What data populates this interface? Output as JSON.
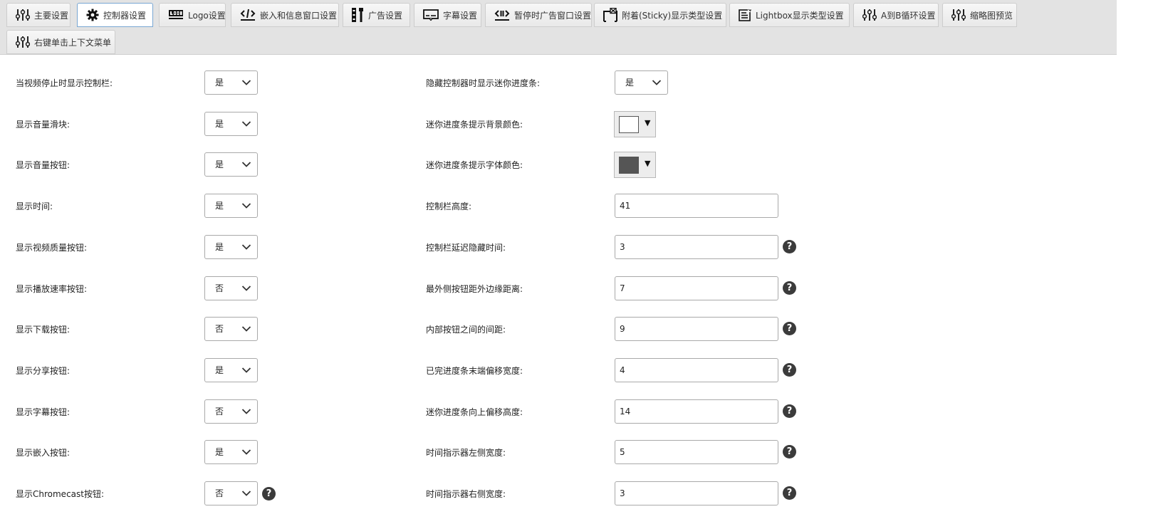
{
  "tabs": [
    {
      "label": "主要设置",
      "icon": "sliders-icon",
      "active": false
    },
    {
      "label": "控制器设置",
      "icon": "gear-icon",
      "active": true
    },
    {
      "label": "Logo设置",
      "icon": "logo-icon",
      "active": false
    },
    {
      "label": "嵌入和信息窗口设置",
      "icon": "embed-icon",
      "active": false
    },
    {
      "label": "广告设置",
      "icon": "ad-icon",
      "active": false
    },
    {
      "label": "字幕设置",
      "icon": "subtitle-icon",
      "active": false
    },
    {
      "label": "暂停时广告窗口设置",
      "icon": "pause-ad-icon",
      "active": false
    },
    {
      "label": "附着(Sticky)显示类型设置",
      "icon": "sticky-icon",
      "active": false
    },
    {
      "label": "Lightbox显示类型设置",
      "icon": "lightbox-icon",
      "active": false
    },
    {
      "label": "A到B循环设置",
      "icon": "sliders-icon",
      "active": false
    },
    {
      "label": "缩略图预览",
      "icon": "sliders-icon",
      "active": false
    },
    {
      "label": "右键单击上下文菜单",
      "icon": "sliders-icon",
      "active": false
    }
  ],
  "left_settings": [
    {
      "label": "当视频停止时显示控制栏:",
      "value": "是"
    },
    {
      "label": "显示音量滑块:",
      "value": "是"
    },
    {
      "label": "显示音量按钮:",
      "value": "是"
    },
    {
      "label": "显示时间:",
      "value": "是"
    },
    {
      "label": "显示视频质量按钮:",
      "value": "是"
    },
    {
      "label": "显示播放速率按钮:",
      "value": "否"
    },
    {
      "label": "显示下载按钮:",
      "value": "否"
    },
    {
      "label": "显示分享按钮:",
      "value": "是"
    },
    {
      "label": "显示字幕按钮:",
      "value": "否"
    },
    {
      "label": "显示嵌入按钮:",
      "value": "是"
    },
    {
      "label": "显示Chromecast按钮:",
      "value": "否",
      "help": true
    }
  ],
  "right_settings": [
    {
      "label": "隐藏控制器时显示迷你进度条:",
      "type": "select",
      "value": "是"
    },
    {
      "label": "迷你进度条提示背景颜色:",
      "type": "color",
      "color": "#ffffff"
    },
    {
      "label": "迷你进度条提示字体颜色:",
      "type": "color",
      "color": "#555555"
    },
    {
      "label": "控制栏高度:",
      "type": "text",
      "value": "41"
    },
    {
      "label": "控制栏延迟隐藏时间:",
      "type": "text",
      "value": "3",
      "help": true
    },
    {
      "label": "最外侧按钮距外边缘距离:",
      "type": "text",
      "value": "7",
      "help": true
    },
    {
      "label": "内部按钮之间的间距:",
      "type": "text",
      "value": "9",
      "help": true
    },
    {
      "label": "已完进度条末端偏移宽度:",
      "type": "text",
      "value": "4",
      "help": true
    },
    {
      "label": "迷你进度条向上偏移高度:",
      "type": "text",
      "value": "14",
      "help": true
    },
    {
      "label": "时间指示器左侧宽度:",
      "type": "text",
      "value": "5",
      "help": true
    },
    {
      "label": "时间指示器右侧宽度:",
      "type": "text",
      "value": "3",
      "help": true
    }
  ],
  "help_glyph": "?",
  "dropdown_arrow": "▼"
}
